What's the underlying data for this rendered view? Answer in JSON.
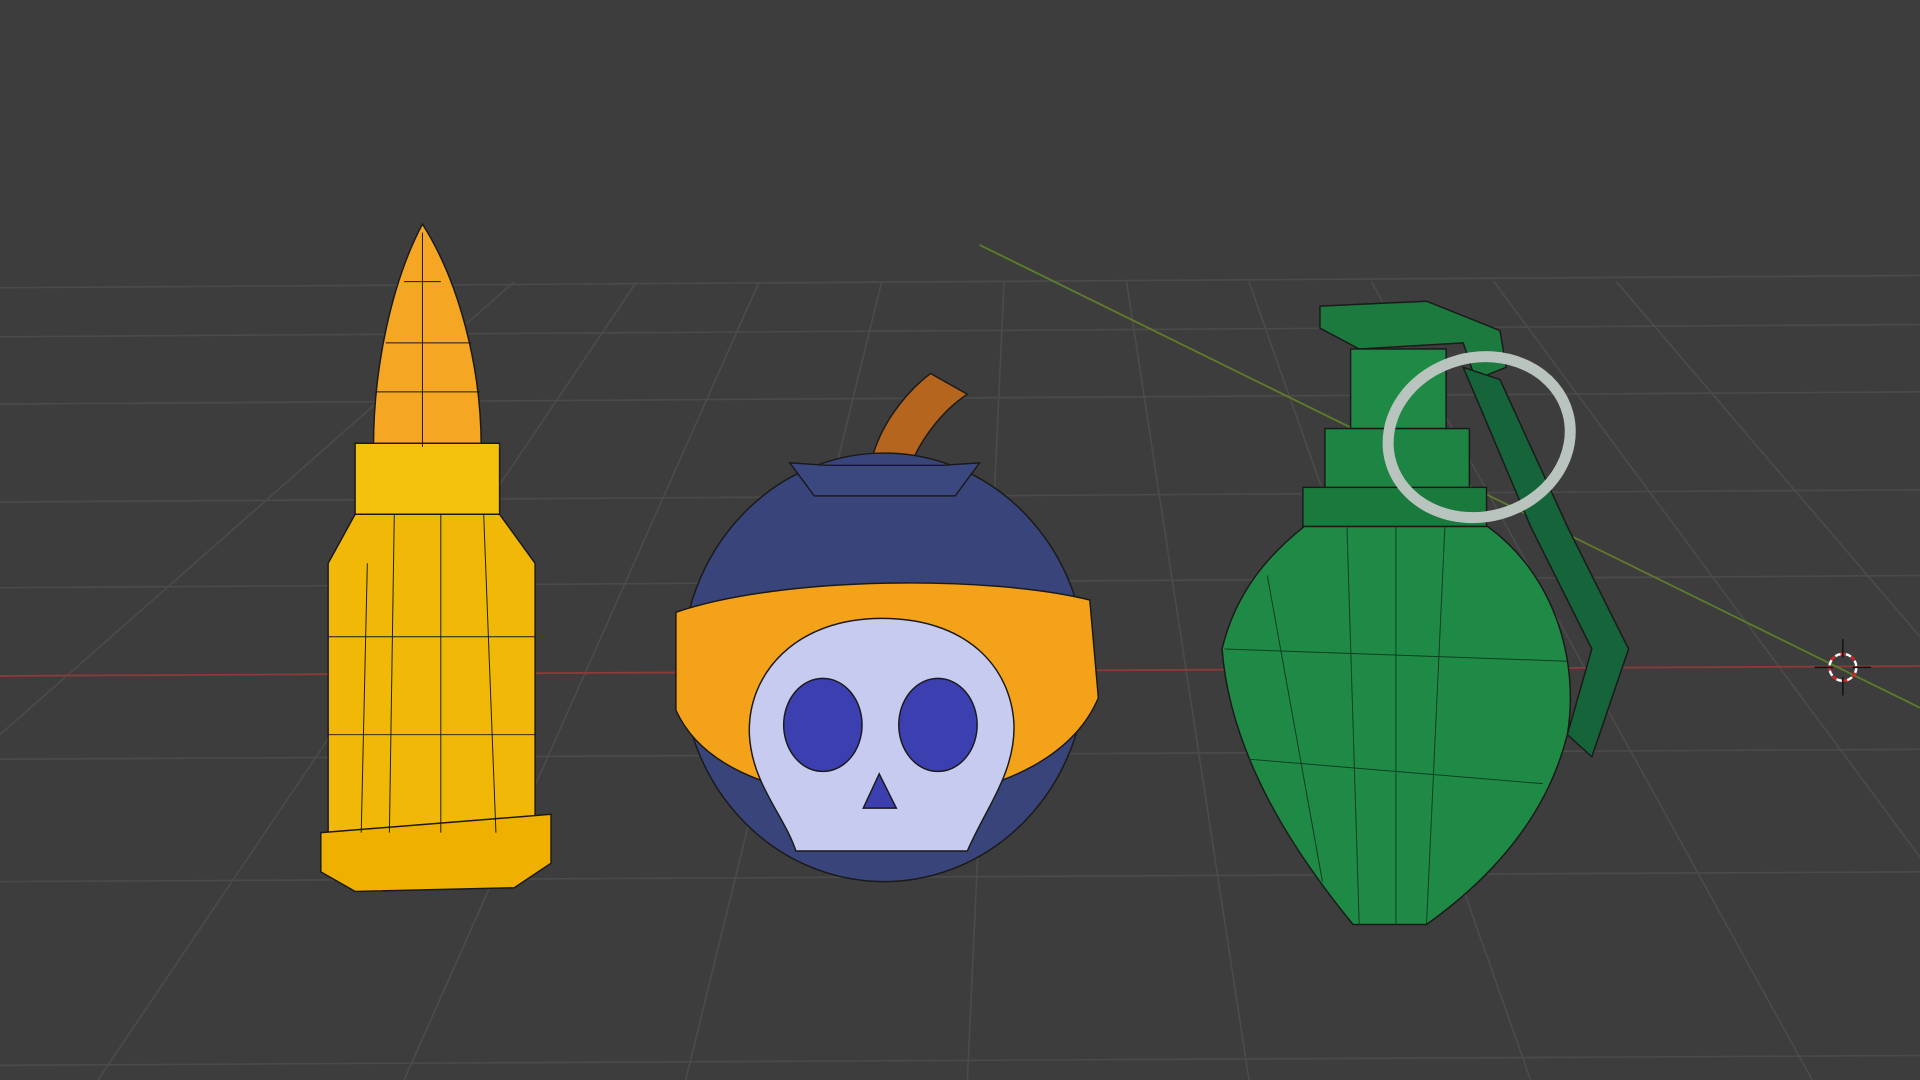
{
  "viewport": {
    "background": "#3d3d3d",
    "grid_color": "#4a4a4a",
    "x_axis_color": "#9a3b3b",
    "y_axis_color": "#6b8a2e"
  },
  "objects": {
    "bullet": {
      "casing": "#f2b807",
      "tip": "#f5a623",
      "wire": "#1a1a1a"
    },
    "bomb": {
      "body": "#39457a",
      "band": "#f4a21a",
      "skull": "#c8cbf0",
      "eyes": "#3c3fb0",
      "fuse": "#b5651d"
    },
    "grenade": {
      "body": "#1f8a45",
      "dark": "#15643a",
      "ring": "#b8c4bd"
    }
  }
}
